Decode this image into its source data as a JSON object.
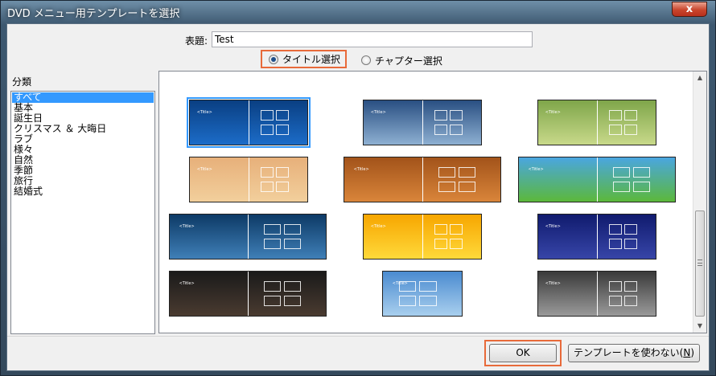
{
  "window": {
    "title": "DVD メニュー用テンプレートを選択",
    "close_glyph": "x",
    "close_icon": "close-icon"
  },
  "subject": {
    "label": "表題:",
    "value": "Test"
  },
  "radios": [
    {
      "label": "タイトル選択",
      "checked": true
    },
    {
      "label": "チャプター選択",
      "checked": false
    }
  ],
  "categories": {
    "label": "分類",
    "items": [
      "すべて",
      "基本",
      "誕生日",
      "クリスマス ＆ 大晦日",
      "ラブ",
      "様々",
      "自然",
      "季節",
      "旅行",
      "結婚式"
    ],
    "selected_index": 0
  },
  "templates": [
    {
      "theme": "winter-forest-blue",
      "colors": [
        "#0a3f82",
        "#1c6cc8"
      ],
      "selected": true
    },
    {
      "theme": "snowy-trees",
      "colors": [
        "#294f82",
        "#8eb0d2"
      ],
      "selected": false
    },
    {
      "theme": "spring-park",
      "colors": [
        "#7fa64a",
        "#c8d98a"
      ],
      "selected": false
    },
    {
      "theme": "autumn-leaves-pale",
      "colors": [
        "#e7b07a",
        "#f2cf9c"
      ],
      "selected": false
    },
    {
      "theme": "autumn-pumpkin",
      "colors": [
        "#a2531a",
        "#d9853a"
      ],
      "selected": false
    },
    {
      "theme": "cartoon-meadow",
      "colors": [
        "#4aa6e0",
        "#5cb83a"
      ],
      "selected": false
    },
    {
      "theme": "blue-waves",
      "colors": [
        "#0d3a66",
        "#3f7fb7"
      ],
      "selected": false
    },
    {
      "theme": "sunburst-yellow",
      "colors": [
        "#f7a600",
        "#ffd93a"
      ],
      "selected": false
    },
    {
      "theme": "night-snow",
      "colors": [
        "#101b6e",
        "#3745a8"
      ],
      "selected": false
    },
    {
      "theme": "dark-typewriter",
      "colors": [
        "#1a1a1a",
        "#4a3b30"
      ],
      "selected": false
    },
    {
      "theme": "seaside-town",
      "colors": [
        "#4a8bd0",
        "#a9cfee"
      ],
      "selected": false
    },
    {
      "theme": "wedding-bw",
      "colors": [
        "#3a3a3a",
        "#9a9a9a"
      ],
      "selected": false
    }
  ],
  "template_mini_title": "&lt;Title&gt;",
  "buttons": {
    "ok": "OK",
    "no_template": "テンプレートを使わない(",
    "no_template_key": "N",
    "no_template_end": ")"
  },
  "scroll": {
    "up_glyph": "▲",
    "down_glyph": "▼"
  }
}
